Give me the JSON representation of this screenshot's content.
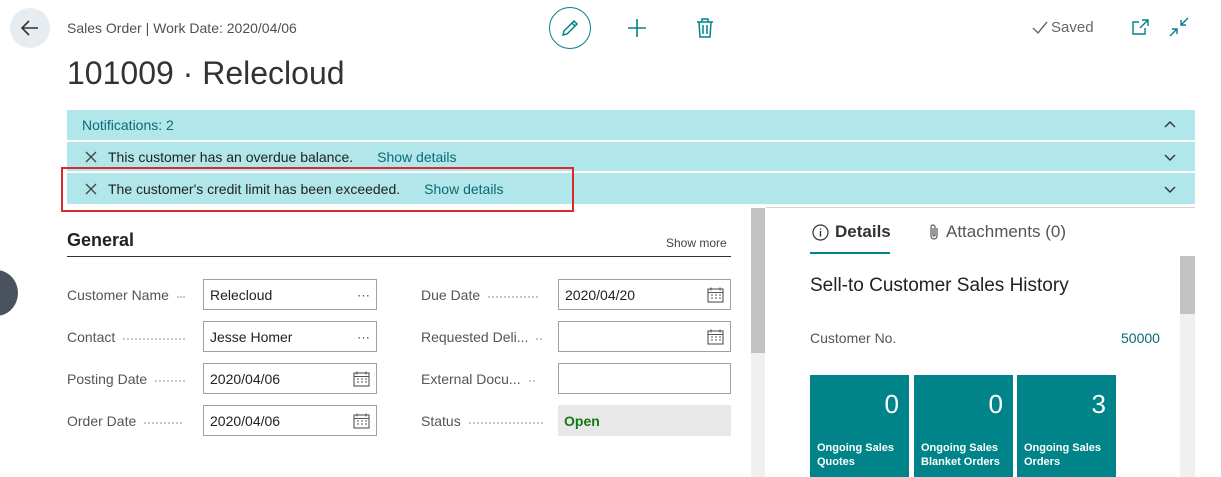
{
  "header": {
    "caption": "Sales Order | Work Date: 2020/04/06",
    "title": "101009 · Relecloud",
    "saved_label": "Saved"
  },
  "notifications": {
    "header": "Notifications: 2",
    "items": [
      {
        "message": "This customer has an overdue balance.",
        "link": "Show details"
      },
      {
        "message": "The customer's credit limit has been exceeded.",
        "link": "Show details"
      }
    ]
  },
  "general": {
    "title": "General",
    "show_more": "Show more",
    "fields": {
      "customer_name": {
        "label": "Customer Name",
        "value": "Relecloud"
      },
      "contact": {
        "label": "Contact",
        "value": "Jesse Homer"
      },
      "posting_date": {
        "label": "Posting Date",
        "value": "2020/04/06"
      },
      "order_date": {
        "label": "Order Date",
        "value": "2020/04/06"
      },
      "due_date": {
        "label": "Due Date",
        "value": "2020/04/20"
      },
      "requested_delivery": {
        "label": "Requested Deli...",
        "value": ""
      },
      "external_doc": {
        "label": "External Docu...",
        "value": ""
      },
      "status": {
        "label": "Status",
        "value": "Open"
      }
    }
  },
  "factbox": {
    "tabs": [
      {
        "label": "Details",
        "icon": "info-icon"
      },
      {
        "label": "Attachments (0)",
        "icon": "paperclip-icon"
      }
    ],
    "history_title": "Sell-to Customer Sales History",
    "customer_no_label": "Customer No.",
    "customer_no_value": "50000",
    "cues": [
      {
        "value": "0",
        "caption_line1": "Ongoing Sales",
        "caption_line2": "Quotes"
      },
      {
        "value": "0",
        "caption_line1": "Ongoing Sales",
        "caption_line2": "Blanket Orders"
      },
      {
        "value": "3",
        "caption_line1": "Ongoing Sales",
        "caption_line2": "Orders"
      }
    ]
  },
  "colors": {
    "accent": "#00838a",
    "notification_bg": "#b1e7ea",
    "cue_bg": "#008489",
    "status_open": "#107c10",
    "highlight": "#d92b2b"
  }
}
